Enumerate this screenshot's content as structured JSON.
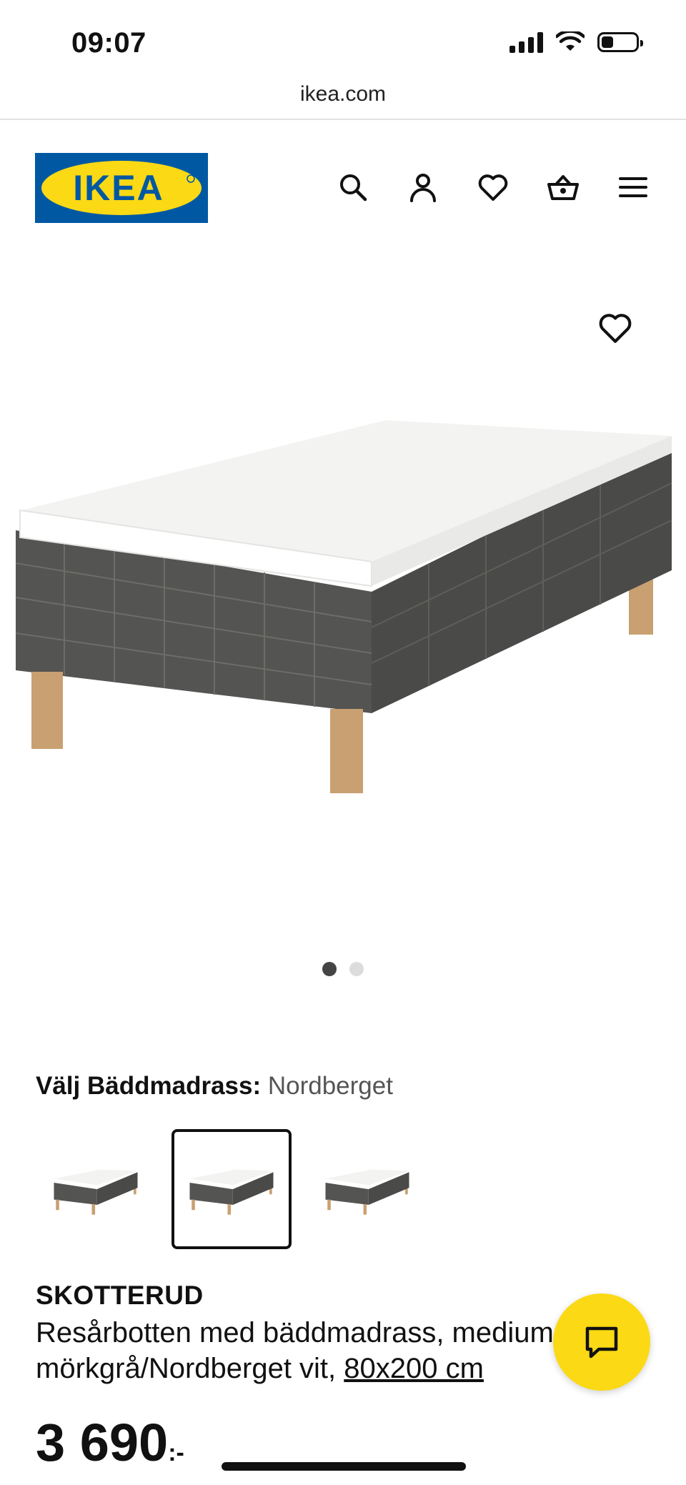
{
  "status_bar": {
    "time": "09:07",
    "battery_level": 0.35
  },
  "browser": {
    "url": "ikea.com"
  },
  "header": {
    "logo_text": "IKEA",
    "brand_colors": {
      "blue": "#0058a3",
      "yellow": "#fbd914"
    },
    "icons": [
      "search-icon",
      "account-icon",
      "heart-icon",
      "cart-icon",
      "menu-icon"
    ]
  },
  "gallery": {
    "image_count": 2,
    "active_index": 0
  },
  "variant": {
    "label": "Välj Bäddmadrass:",
    "selected": "Nordberget",
    "options": 3,
    "selected_index": 1
  },
  "product": {
    "name": "SKOTTERUD",
    "description": "Resårbotten med bäddmadrass, medium, mörkgrå/Nordberget vit,",
    "size_link": "80x200 cm",
    "price": "3 690",
    "price_suffix": ":-"
  },
  "chat": {
    "icon": "chat-icon",
    "color": "#fbd914"
  }
}
